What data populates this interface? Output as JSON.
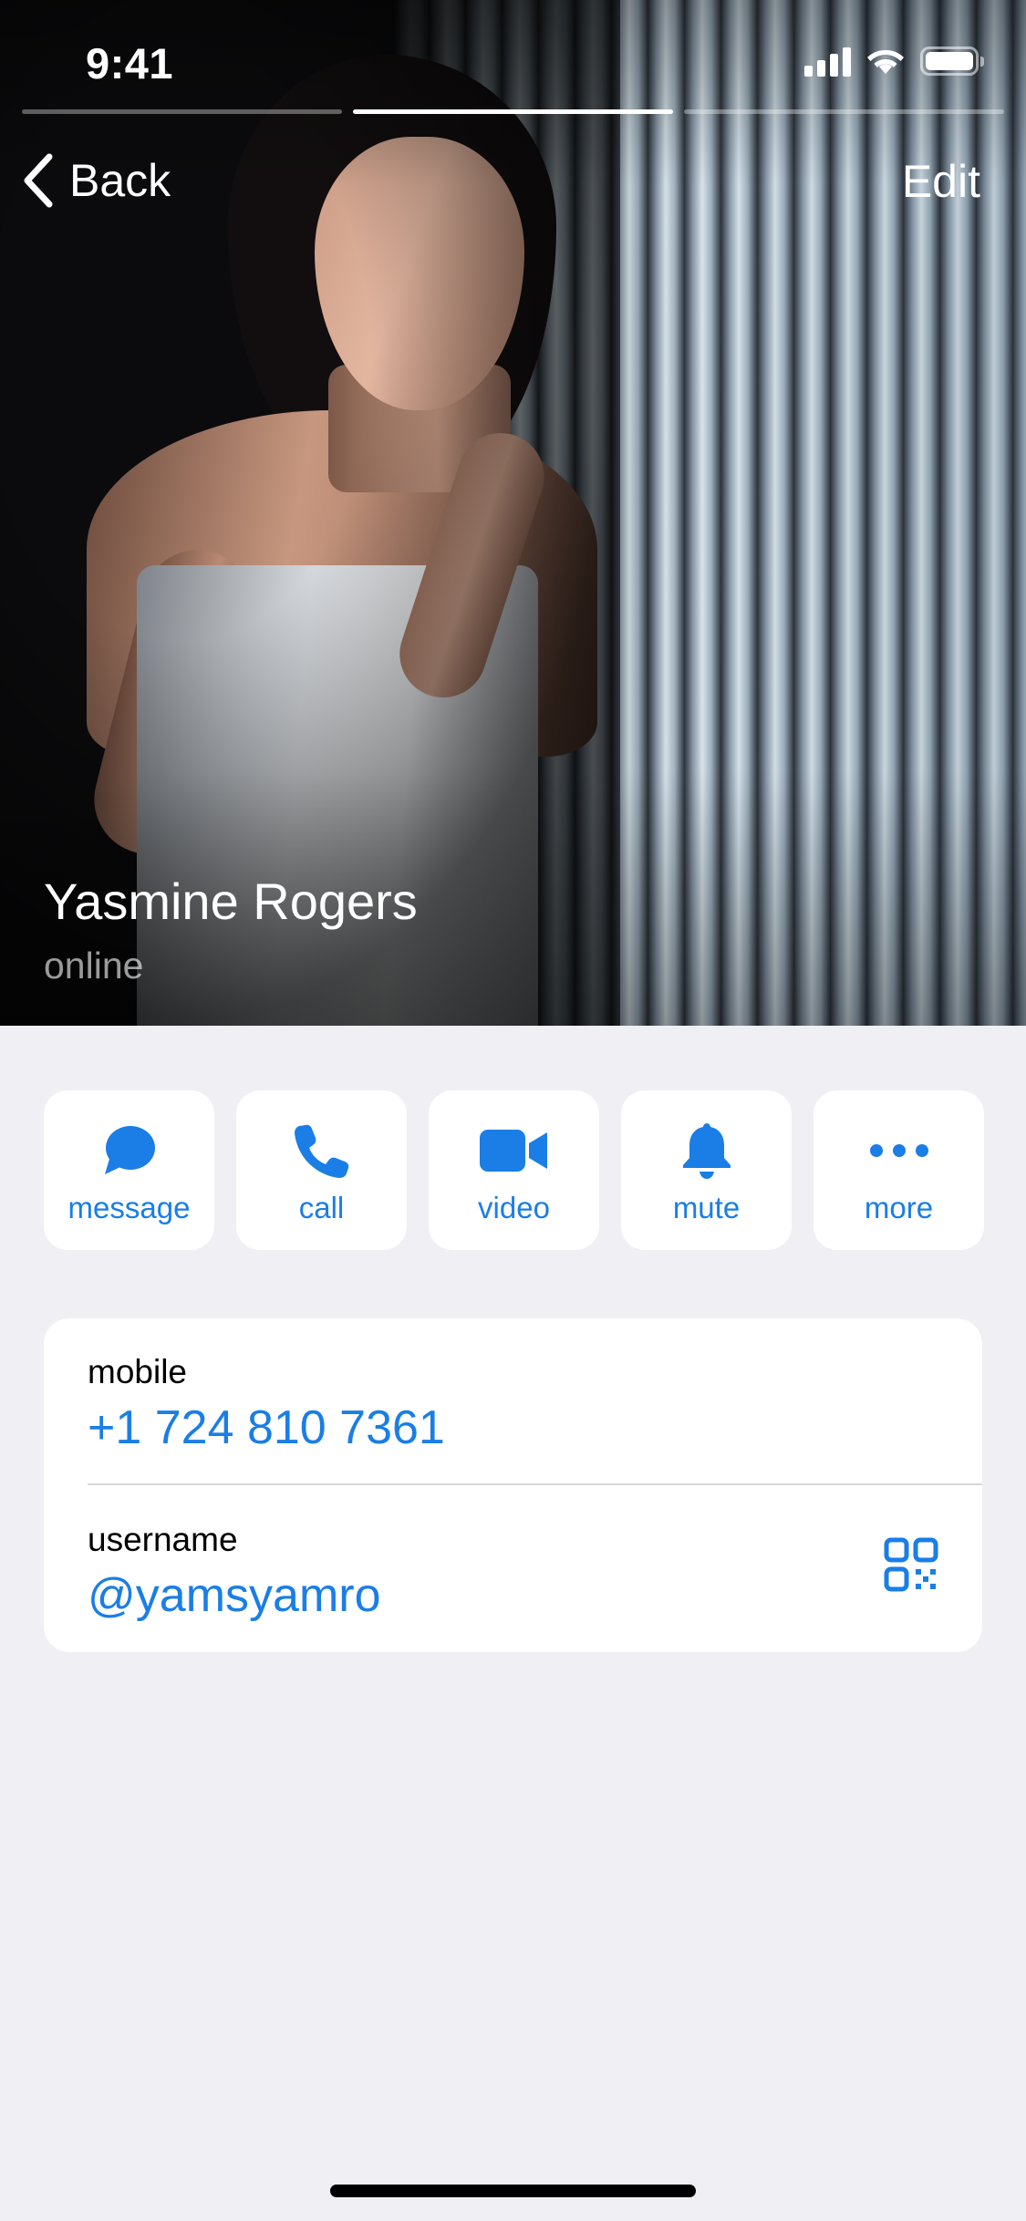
{
  "status_bar": {
    "time": "9:41"
  },
  "story_progress": {
    "segments": 3,
    "active_index": 1
  },
  "nav": {
    "back_label": "Back",
    "edit_label": "Edit"
  },
  "profile": {
    "name": "Yasmine Rogers",
    "status": "online"
  },
  "actions": [
    {
      "icon": "message-bubble-icon",
      "label": "message"
    },
    {
      "icon": "phone-icon",
      "label": "call"
    },
    {
      "icon": "video-camera-icon",
      "label": "video"
    },
    {
      "icon": "bell-icon",
      "label": "mute"
    },
    {
      "icon": "more-dots-icon",
      "label": "more"
    }
  ],
  "info": {
    "mobile": {
      "caption": "mobile",
      "value": "+1 724 810 7361"
    },
    "username": {
      "caption": "username",
      "value": "@yamsyamro"
    }
  },
  "colors": {
    "accent": "#1a7ee6",
    "background": "#efeff4",
    "card": "#ffffff"
  }
}
